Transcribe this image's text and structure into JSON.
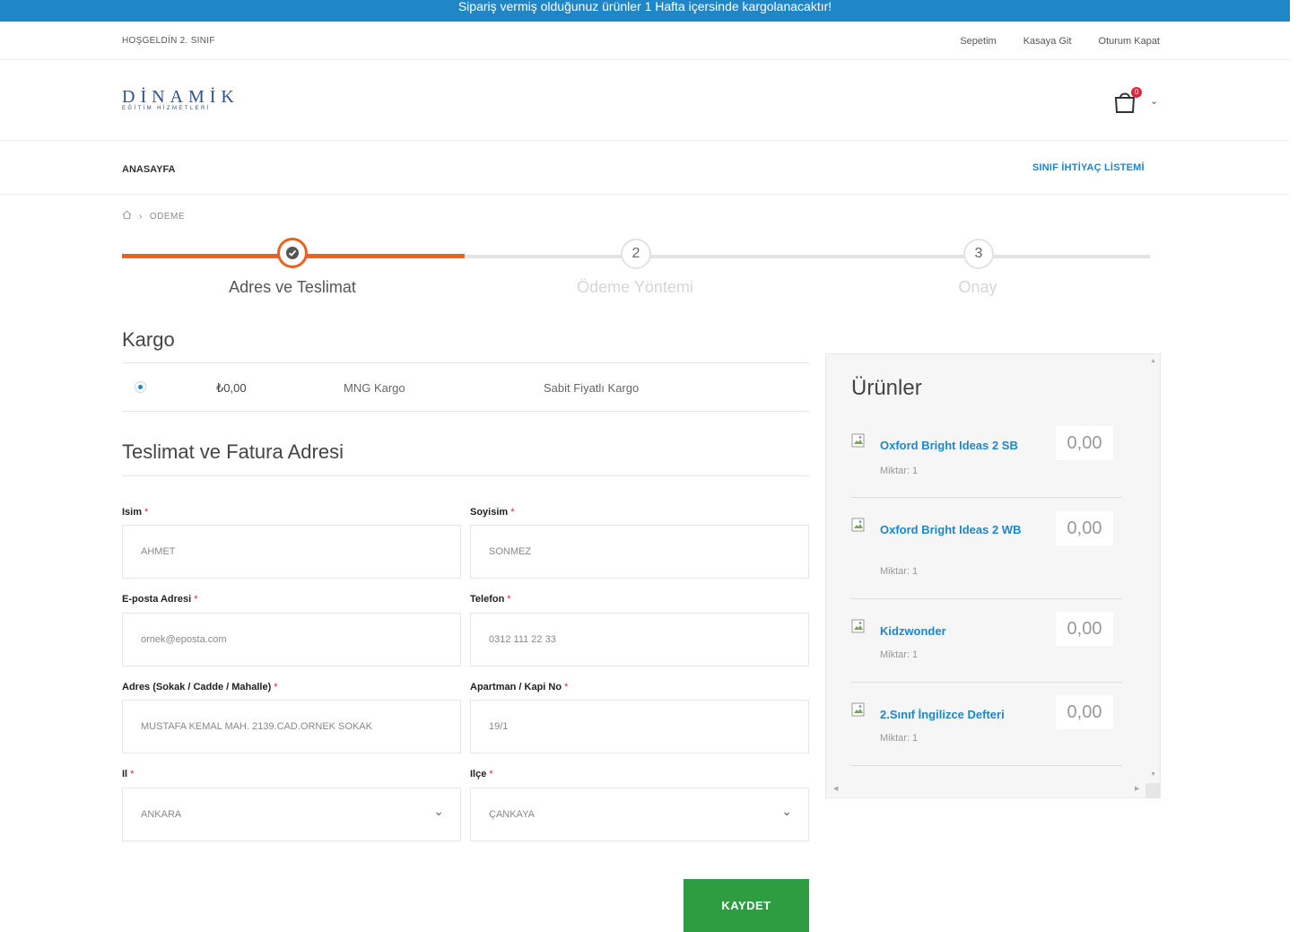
{
  "announcement": "Sipariş vermiş olduğunuz ürünler 1 Hafta içersinde kargolanacaktır!",
  "header": {
    "welcome": "HOŞGELDİN 2. SINIF",
    "links": [
      "Sepetim",
      "Kasaya Git",
      "Oturum Kapat"
    ],
    "logo_main": "DİNAMİK",
    "logo_sub": "EĞİTİM HİZMETLERİ",
    "cart_count": "0"
  },
  "nav": {
    "home": "ANASAYFA",
    "needs_list": "SINIF İHTİYAÇ LİSTEMİ"
  },
  "breadcrumb": {
    "current": "ODEME"
  },
  "steps": [
    {
      "number": "1",
      "label": "Adres ve Teslimat",
      "state": "completed"
    },
    {
      "number": "2",
      "label": "Ödeme Yöntemi",
      "state": "inactive"
    },
    {
      "number": "3",
      "label": "Onay",
      "state": "inactive"
    }
  ],
  "kargo": {
    "title": "Kargo",
    "price": "₺0,00",
    "name": "MNG Kargo",
    "type": "Sabit Fiyatlı Kargo",
    "selected": true
  },
  "address": {
    "title": "Teslimat ve Fatura Adresi",
    "fields": {
      "isim": {
        "label": "Isim",
        "value": "AHMET"
      },
      "soyisim": {
        "label": "Soyisim",
        "value": "SONMEZ"
      },
      "email": {
        "label": "E-posta Adresi",
        "value": "ornek@eposta.com"
      },
      "telefon": {
        "label": "Telefon",
        "value": "0312 111 22 33"
      },
      "adres": {
        "label": "Adres (Sokak / Cadde / Mahalle)",
        "value": "MUSTAFA KEMAL MAH. 2139.CAD.ORNEK SOKAK"
      },
      "apartman": {
        "label": "Apartman / Kapi No",
        "value": "19/1"
      },
      "il": {
        "label": "Il",
        "value": "ANKARA"
      },
      "ilce": {
        "label": "Ilçe",
        "value": "ÇANKAYA"
      }
    },
    "required_mark": "*"
  },
  "save_button": "KAYDET",
  "sidebar": {
    "title": "Ürünler",
    "products": [
      {
        "name": "Oxford Bright Ideas 2 SB",
        "qty": "Miktar: 1",
        "price": "0,00"
      },
      {
        "name": "Oxford Bright Ideas 2 WB",
        "qty": "Miktar: 1",
        "price": "0,00"
      },
      {
        "name": "Kidzwonder",
        "qty": "Miktar: 1",
        "price": "0,00"
      },
      {
        "name": "2.Sınıf İngilizce Defteri",
        "qty": "Miktar: 1",
        "price": "0,00"
      }
    ]
  },
  "colors": {
    "brand_blue": "#1f86c8",
    "step_orange": "#e8631f",
    "save_green": "#2e9d42",
    "required_red": "#e0263a"
  }
}
